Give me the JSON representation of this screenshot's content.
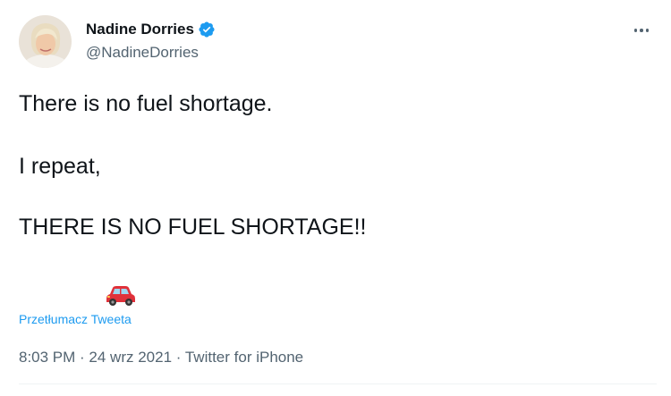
{
  "author": {
    "display_name": "Nadine Dorries",
    "handle": "@NadineDorries",
    "verified": true
  },
  "tweet": {
    "lines": [
      "There is no fuel shortage.",
      "I repeat,",
      "THERE IS NO FUEL SHORTAGE!!"
    ],
    "emoji": "car-emoji"
  },
  "translate_label": "Przetłumacz Tweeta",
  "meta": {
    "time": "8:03 PM",
    "separator": " · ",
    "date": "24 wrz 2021",
    "source": "Twitter for iPhone"
  },
  "colors": {
    "accent": "#1d9bf0",
    "text": "#0f1419",
    "secondary": "#536471",
    "car": "#e0313a"
  }
}
